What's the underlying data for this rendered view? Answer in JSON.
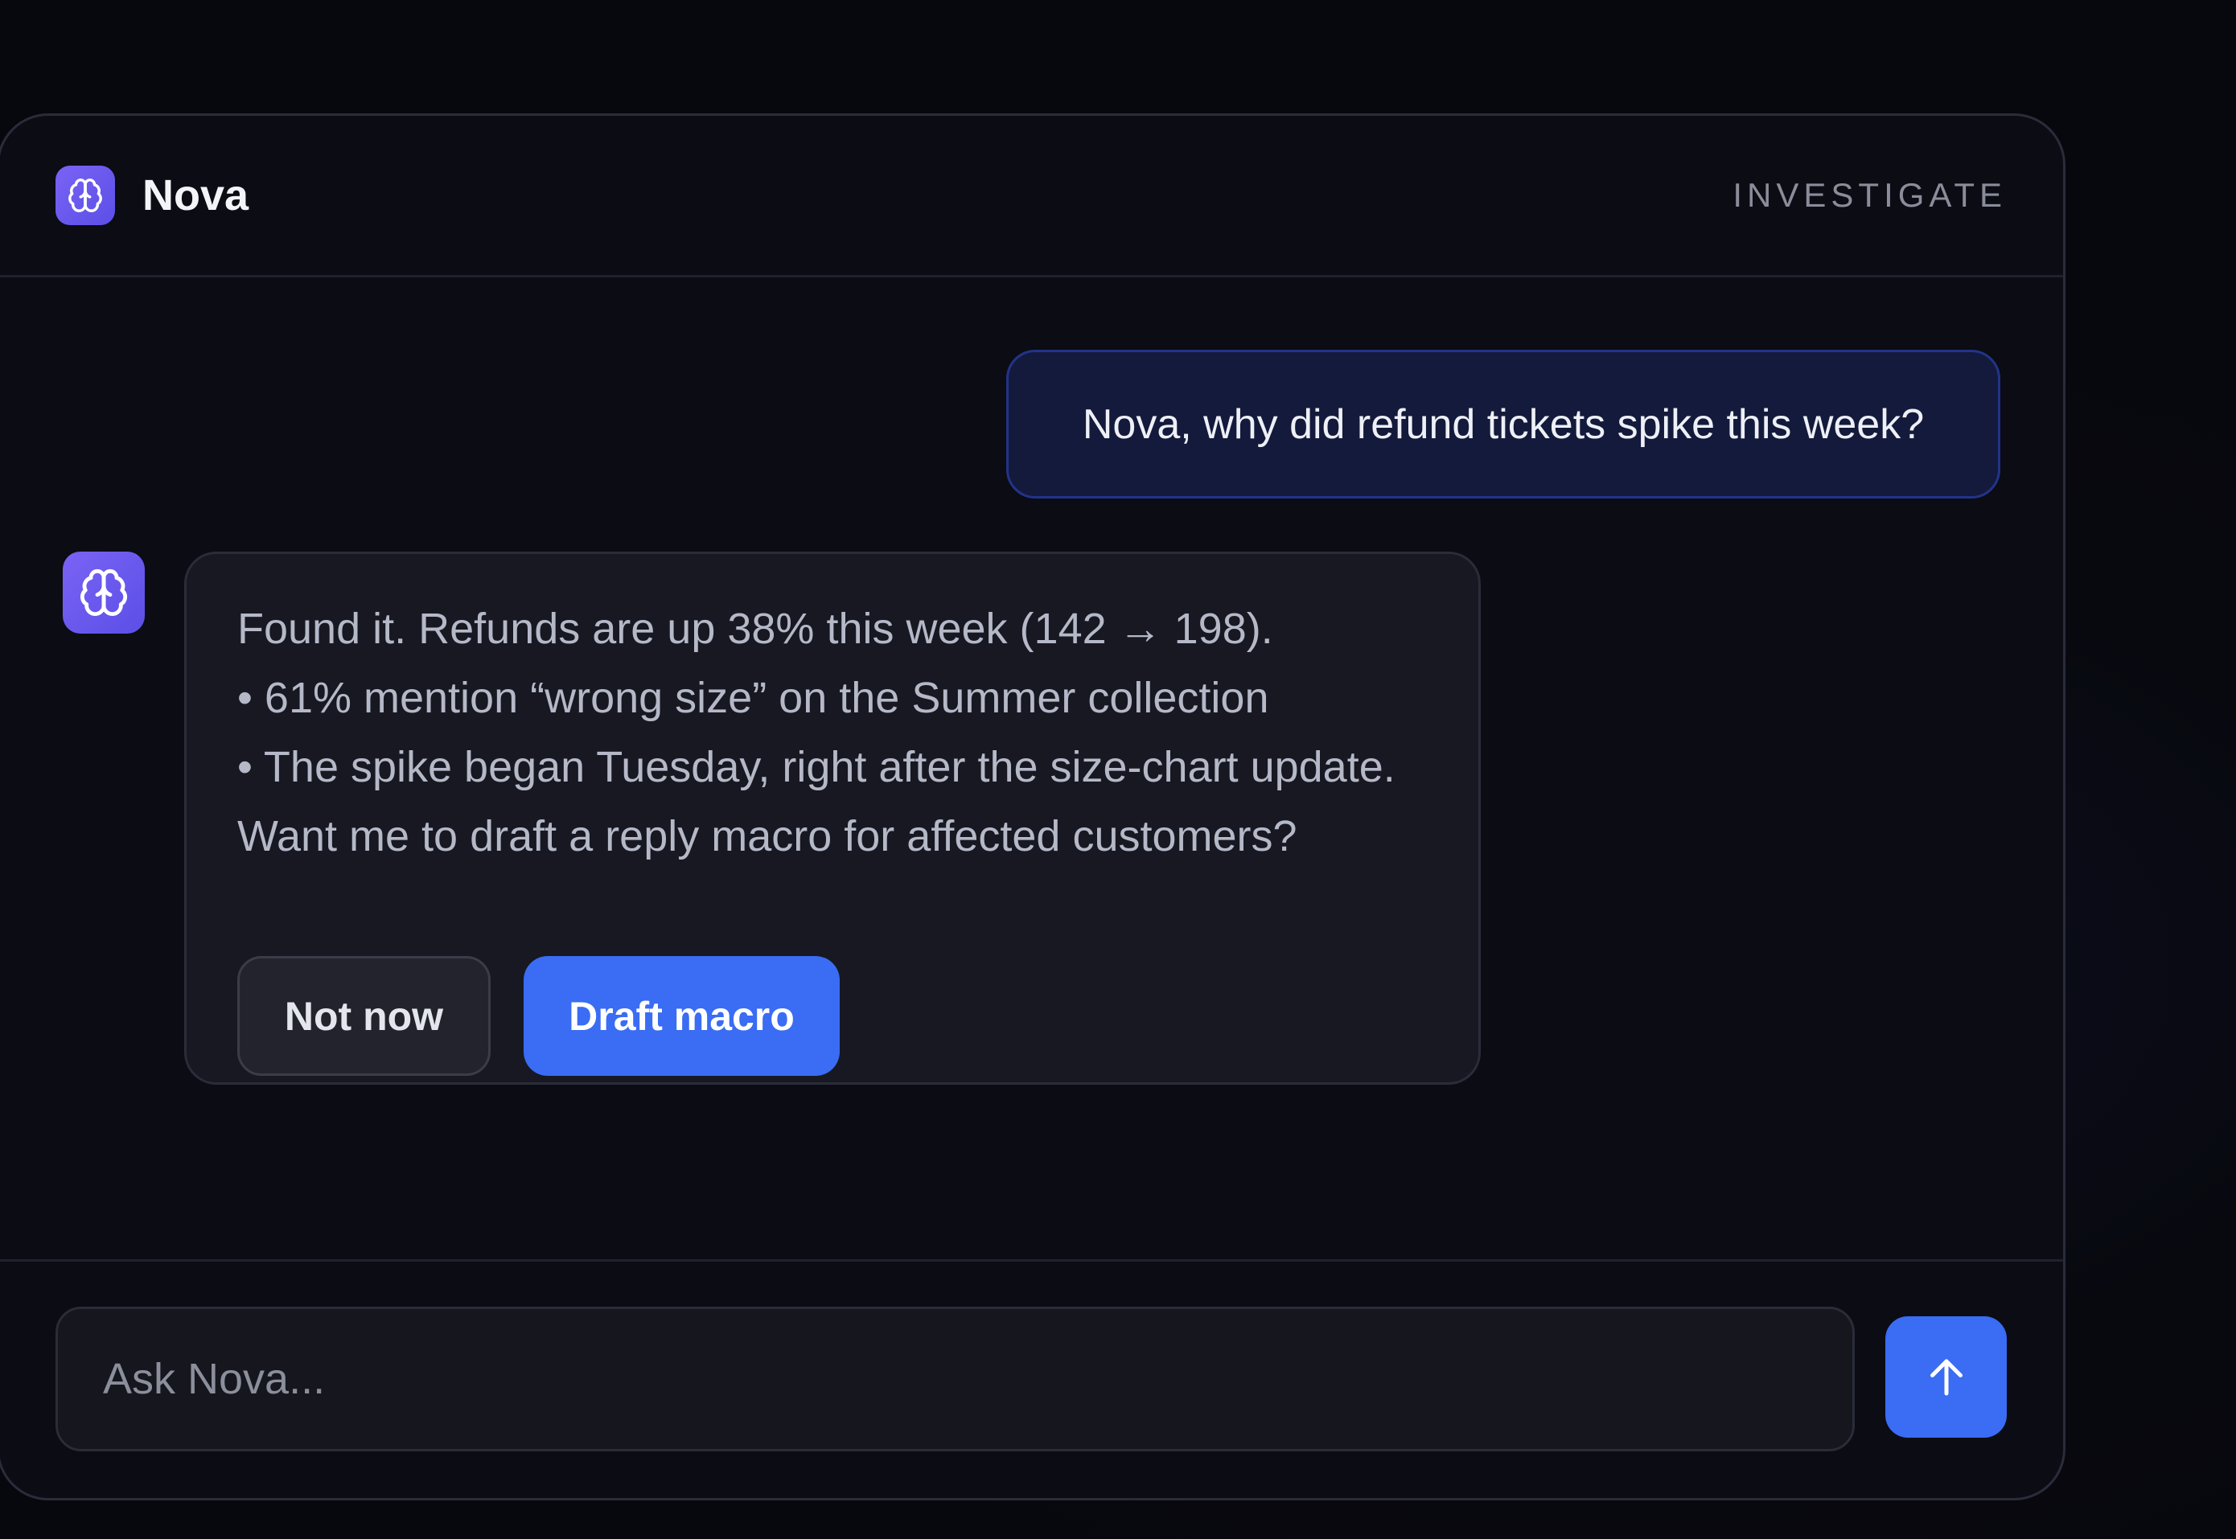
{
  "header": {
    "app_name": "Nova",
    "mode_label": "INVESTIGATE",
    "logo_icon": "brain-icon"
  },
  "conversation": {
    "user_message": "Nova, why did refund tickets spike this week?",
    "assistant": {
      "avatar_icon": "brain-icon",
      "lines": [
        "Found it. Refunds are up 38% this week (142 → 198).",
        "• 61% mention “wrong size” on the Summer collection",
        "• The spike began Tuesday, right after the size-chart update.",
        "Want me to draft a reply macro for affected customers?"
      ],
      "actions": {
        "secondary_label": "Not now",
        "primary_label": "Draft macro"
      }
    }
  },
  "composer": {
    "placeholder": "Ask Nova...",
    "value": "",
    "send_icon": "arrow-up-icon"
  },
  "colors": {
    "accent": "#3a6cf4",
    "logo_gradient_start": "#7a63f5",
    "logo_gradient_end": "#5b4fe6",
    "user_bubble_bg": "#141a3b",
    "user_bubble_border": "#23338a",
    "window_bg": "#0b0c14"
  }
}
